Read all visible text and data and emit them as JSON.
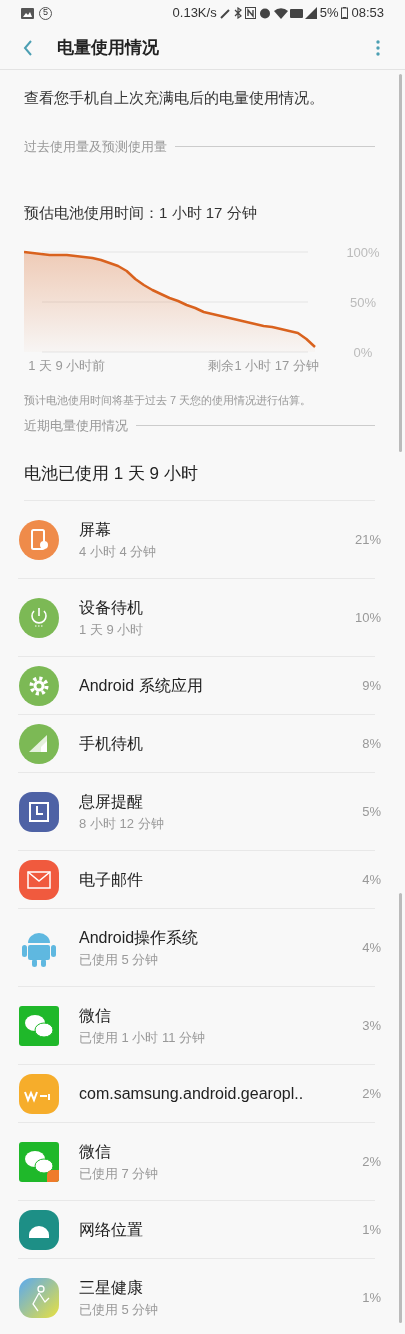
{
  "status_bar": {
    "notification_count": "5",
    "speed": "0.13K/s",
    "battery": "5%",
    "time": "08:53"
  },
  "header": {
    "title": "电量使用情况"
  },
  "intro": "查看您手机自上次充满电后的电量使用情况。",
  "section_1": {
    "title": "过去使用量及预测使用量"
  },
  "estimate": "预估电池使用时间：1 小时 17 分钟",
  "chart_data": {
    "type": "area",
    "categories": [
      null,
      null,
      null,
      null,
      null,
      "1 天 9 小时前",
      null,
      null,
      null,
      null,
      null,
      null,
      null,
      null,
      null,
      null,
      null,
      null,
      null,
      null,
      null,
      null,
      null,
      null,
      null,
      null,
      null,
      null,
      "剩余1 小时 17 分钟",
      null,
      null,
      null,
      null,
      null,
      null
    ],
    "series": [
      {
        "color": "#d9621e",
        "values": [
          100,
          99,
          98,
          97,
          97,
          97,
          96,
          95,
          94,
          92,
          89,
          86,
          81,
          73,
          67,
          62,
          58,
          54,
          51,
          47,
          44,
          40,
          38,
          36,
          34,
          32,
          30,
          28,
          26,
          25,
          23,
          21,
          19,
          13,
          5
        ]
      }
    ],
    "yticks": [
      {
        "value": 0,
        "label": "0%"
      },
      {
        "value": 50,
        "label": "50%"
      },
      {
        "value": 100,
        "label": "100%"
      }
    ],
    "ylim": [
      0,
      100
    ]
  },
  "footnote": "预计电池使用时间将基于过去 7 天您的使用情况进行估算。",
  "section_2": {
    "title": "近期电量使用情况"
  },
  "battery_used": "电池已使用 1 天 9 小时",
  "apps": [
    {
      "name": "屏幕",
      "detail": "4 小时 4 分钟",
      "percent": "21%"
    },
    {
      "name": "设备待机",
      "detail": "1 天 9 小时",
      "percent": "10%"
    },
    {
      "name": "Android 系统应用",
      "percent": "9%"
    },
    {
      "name": "手机待机",
      "percent": "8%"
    },
    {
      "name": "息屏提醒",
      "detail": "8 小时 12 分钟",
      "percent": "5%"
    },
    {
      "name": "电子邮件",
      "percent": "4%"
    },
    {
      "name": "Android操作系统",
      "detail": "已使用 5 分钟",
      "percent": "4%"
    },
    {
      "name": "微信",
      "detail": "已使用 1 小时 11 分钟",
      "percent": "3%"
    },
    {
      "name": "com.samsung.android.gearopl..",
      "percent": "2%"
    },
    {
      "name": "微信",
      "detail": "已使用 7 分钟",
      "percent": "2%"
    },
    {
      "name": "网络位置",
      "percent": "1%"
    },
    {
      "name": "三星健康",
      "detail": "已使用 5 分钟",
      "percent": "1%"
    }
  ]
}
